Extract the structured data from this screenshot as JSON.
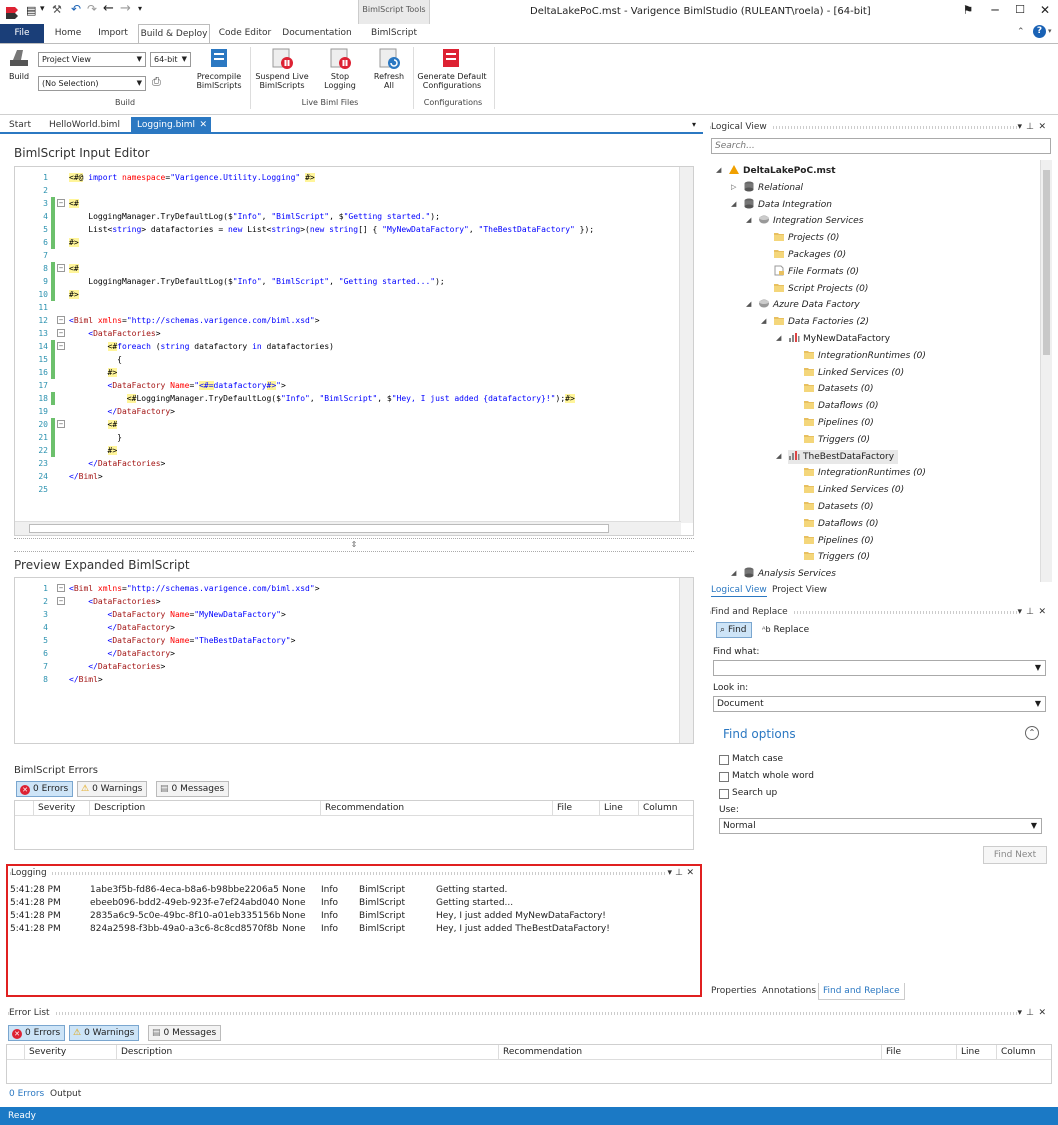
{
  "window": {
    "title": "DeltaLakePoC.mst - Varigence BimlStudio (RULEANT\\roela) - [64-bit]",
    "contextual_tab_group": "BimlScript Tools"
  },
  "ribbon": {
    "tabs": [
      "File",
      "Home",
      "Import",
      "Build & Deploy",
      "Code Editor",
      "Documentation",
      "BimlScript"
    ],
    "build": {
      "build_label": "Build",
      "view_combo": "Project View",
      "bitness_combo": "64-bit",
      "selection_combo": "(No Selection)",
      "precompile_label": "Precompile BimlScripts",
      "group_label": "Build"
    },
    "live": {
      "suspend_label": "Suspend Live BimlScripts",
      "stop_label": "Stop Logging",
      "refresh_label": "Refresh All",
      "group_label": "Live Biml Files"
    },
    "configs": {
      "generate_label": "Generate Default Configurations",
      "group_label": "Configurations"
    }
  },
  "doc_tabs": [
    "Start",
    "HelloWorld.biml",
    "Logging.biml"
  ],
  "input_editor": {
    "title": "BimlScript Input Editor",
    "lines": [
      {
        "n": "1",
        "t": "<#@ import namespace=\"Varigence.Utility.Logging\" #>"
      },
      {
        "n": "2",
        "t": ""
      },
      {
        "n": "3",
        "t": "<#"
      },
      {
        "n": "4",
        "t": "    LoggingManager.TryDefaultLog($\"Info\", \"BimlScript\", $\"Getting started.\");"
      },
      {
        "n": "5",
        "t": "    List<string> datafactories = new List<string>(new string[] { \"MyNewDataFactory\", \"TheBestDataFactory\" });"
      },
      {
        "n": "6",
        "t": "#>"
      },
      {
        "n": "7",
        "t": ""
      },
      {
        "n": "8",
        "t": "<#"
      },
      {
        "n": "9",
        "t": "    LoggingManager.TryDefaultLog($\"Info\", \"BimlScript\", \"Getting started...\");"
      },
      {
        "n": "10",
        "t": "#>"
      },
      {
        "n": "11",
        "t": ""
      },
      {
        "n": "12",
        "t": "<Biml xmlns=\"http://schemas.varigence.com/biml.xsd\">"
      },
      {
        "n": "13",
        "t": "    <DataFactories>"
      },
      {
        "n": "14",
        "t": "        <#foreach (string datafactory in datafactories)"
      },
      {
        "n": "15",
        "t": "          {"
      },
      {
        "n": "16",
        "t": "        #>"
      },
      {
        "n": "17",
        "t": "        <DataFactory Name=\"<#=datafactory#>\">"
      },
      {
        "n": "18",
        "t": "            <#LoggingManager.TryDefaultLog($\"Info\", \"BimlScript\", $\"Hey, I just added {datafactory}!\");#>"
      },
      {
        "n": "19",
        "t": "        </DataFactory>"
      },
      {
        "n": "20",
        "t": "        <#"
      },
      {
        "n": "21",
        "t": "          }"
      },
      {
        "n": "22",
        "t": "        #>"
      },
      {
        "n": "23",
        "t": "    </DataFactories>"
      },
      {
        "n": "24",
        "t": "</Biml>"
      },
      {
        "n": "25",
        "t": ""
      }
    ]
  },
  "preview": {
    "title": "Preview Expanded BimlScript",
    "lines": [
      {
        "n": "1",
        "t": "<Biml xmlns=\"http://schemas.varigence.com/biml.xsd\">"
      },
      {
        "n": "2",
        "t": "    <DataFactories>"
      },
      {
        "n": "3",
        "t": "        <DataFactory Name=\"MyNewDataFactory\">"
      },
      {
        "n": "4",
        "t": "        </DataFactory>"
      },
      {
        "n": "5",
        "t": "        <DataFactory Name=\"TheBestDataFactory\">"
      },
      {
        "n": "6",
        "t": "        </DataFactory>"
      },
      {
        "n": "7",
        "t": "    </DataFactories>"
      },
      {
        "n": "8",
        "t": "</Biml>"
      }
    ]
  },
  "bimlscript_errors": {
    "title": "BimlScript Errors",
    "errors": "0 Errors",
    "warnings": "0 Warnings",
    "messages": "0 Messages",
    "columns": [
      "Severity",
      "Description",
      "Recommendation",
      "File",
      "Line",
      "Column"
    ]
  },
  "logging": {
    "title": "Logging",
    "rows": [
      {
        "time": "5:41:28 PM",
        "id": "1abe3f5b-fd86-4eca-b8a6-b98bbe2206a5",
        "a": "None",
        "level": "Info",
        "src": "BimlScript",
        "msg": "Getting started."
      },
      {
        "time": "5:41:28 PM",
        "id": "ebeeb096-bdd2-49eb-923f-e7ef24abd040",
        "a": "None",
        "level": "Info",
        "src": "BimlScript",
        "msg": "Getting started..."
      },
      {
        "time": "5:41:28 PM",
        "id": "2835a6c9-5c0e-49bc-8f10-a01eb335156b",
        "a": "None",
        "level": "Info",
        "src": "BimlScript",
        "msg": "Hey, I just added MyNewDataFactory!"
      },
      {
        "time": "5:41:28 PM",
        "id": "824a2598-f3bb-49a0-a3c6-8c8cd8570f8b",
        "a": "None",
        "level": "Info",
        "src": "BimlScript",
        "msg": "Hey, I just added TheBestDataFactory!"
      }
    ]
  },
  "error_list": {
    "title": "Error List",
    "errors": "0 Errors",
    "warnings": "0 Warnings",
    "messages": "0 Messages",
    "columns": [
      "Severity",
      "Description",
      "Recommendation",
      "File",
      "Line",
      "Column"
    ],
    "bottom_tabs": [
      "0 Errors",
      "Output"
    ]
  },
  "logical_view": {
    "title": "Logical View",
    "search_placeholder": "Search...",
    "tree": [
      "DeltaLakePoC.mst",
      "Relational",
      "Data Integration",
      "Integration Services",
      "Projects (0)",
      "Packages (0)",
      "File Formats (0)",
      "Script Projects (0)",
      "Azure Data Factory",
      "Data Factories (2)",
      "MyNewDataFactory",
      "IntegrationRuntimes (0)",
      "Linked Services (0)",
      "Datasets (0)",
      "Dataflows (0)",
      "Pipelines (0)",
      "Triggers (0)",
      "TheBestDataFactory",
      "IntegrationRuntimes (0)",
      "Linked Services (0)",
      "Datasets (0)",
      "Dataflows (0)",
      "Pipelines (0)",
      "Triggers (0)",
      "Analysis Services"
    ],
    "tabs": [
      "Logical View",
      "Project View"
    ]
  },
  "find_replace": {
    "title": "Find and Replace",
    "find_tab": "Find",
    "replace_tab": "Replace",
    "find_what_label": "Find what:",
    "find_what_value": "",
    "look_in_label": "Look in:",
    "look_in_value": "Document",
    "options_title": "Find options",
    "match_case": "Match case",
    "match_whole_word": "Match whole word",
    "search_up": "Search up",
    "use_label": "Use:",
    "use_value": "Normal",
    "find_next": "Find Next"
  },
  "right_bottom_tabs": [
    "Properties",
    "Annotations",
    "Find and Replace"
  ],
  "status": {
    "text": "Ready"
  },
  "colors": {
    "accent": "#2b78c2",
    "status_bar": "#1b79c5",
    "file_tab": "#1a3e78",
    "logging_border": "#e02020"
  }
}
